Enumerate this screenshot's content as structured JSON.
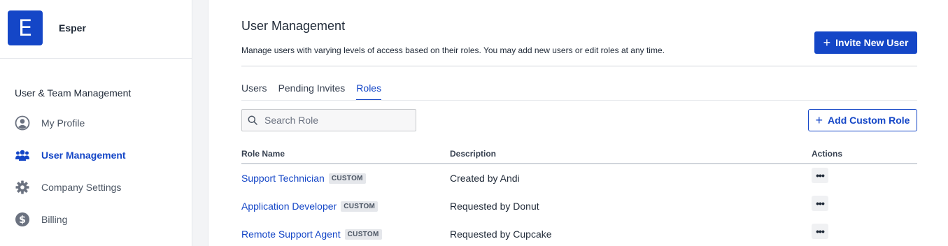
{
  "brand": {
    "logo_letter": "E",
    "org_name": "Esper",
    "color": "#1446c7"
  },
  "sidebar": {
    "section_title": "User & Team Management",
    "items": [
      {
        "label": "My Profile",
        "icon": "user-circle-icon",
        "active": false
      },
      {
        "label": "User Management",
        "icon": "users-icon",
        "active": true
      },
      {
        "label": "Company Settings",
        "icon": "gear-icon",
        "active": false
      },
      {
        "label": "Billing",
        "icon": "dollar-icon",
        "active": false
      }
    ]
  },
  "main": {
    "title": "User Management",
    "description": "Manage users with varying levels of access based on their roles. You may add new users or edit roles at any time.",
    "invite_button": "Invite New User",
    "tabs": [
      {
        "label": "Users",
        "active": false
      },
      {
        "label": "Pending Invites",
        "active": false
      },
      {
        "label": "Roles",
        "active": true
      }
    ],
    "search": {
      "placeholder": "Search Role",
      "value": ""
    },
    "add_button": "Add Custom Role",
    "table": {
      "columns": [
        "Role Name",
        "Description",
        "Actions"
      ],
      "rows": [
        {
          "name": "Support Technician",
          "badge": "CUSTOM",
          "description": "Created by Andi"
        },
        {
          "name": "Application Developer",
          "badge": "CUSTOM",
          "description": "Requested by Donut"
        },
        {
          "name": "Remote Support Agent",
          "badge": "CUSTOM",
          "description": "Requested by Cupcake"
        }
      ]
    }
  }
}
